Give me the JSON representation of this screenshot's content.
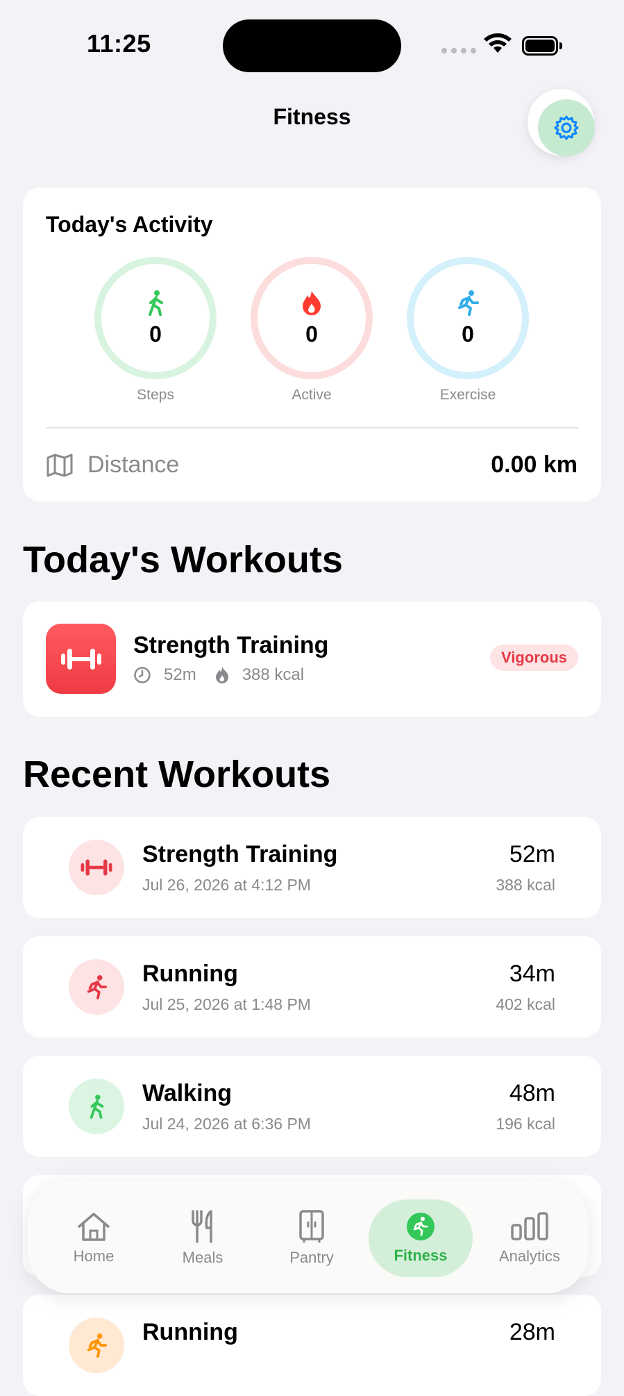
{
  "status_bar": {
    "time": "11:25"
  },
  "header": {
    "title": "Fitness",
    "settings_icon": "gear-icon"
  },
  "activity": {
    "title": "Today's Activity",
    "rings": [
      {
        "icon": "walk-icon",
        "value": "0",
        "label": "Steps",
        "color": "#34c759"
      },
      {
        "icon": "flame-icon",
        "value": "0",
        "label": "Active",
        "color": "#ff3b30"
      },
      {
        "icon": "run-icon",
        "value": "0",
        "label": "Exercise",
        "color": "#32ade6"
      }
    ],
    "distance_label": "Distance",
    "distance_value": "0.00 km"
  },
  "todays_workouts": {
    "title": "Today's Workouts",
    "items": [
      {
        "name": "Strength Training",
        "duration": "52m",
        "kcal": "388 kcal",
        "intensity": "Vigorous",
        "icon": "dumbbell-icon"
      }
    ]
  },
  "recent_workouts": {
    "title": "Recent Workouts",
    "items": [
      {
        "name": "Strength Training",
        "date": "Jul 26, 2026 at 4:12 PM",
        "duration": "52m",
        "kcal": "388 kcal",
        "icon": "dumbbell-icon"
      },
      {
        "name": "Running",
        "date": "Jul 25, 2026 at 1:48 PM",
        "duration": "34m",
        "kcal": "402 kcal",
        "icon": "run-icon"
      },
      {
        "name": "Walking",
        "date": "Jul 24, 2026 at 6:36 PM",
        "duration": "48m",
        "kcal": "196 kcal",
        "icon": "walk-icon"
      },
      {
        "name": "Running",
        "duration": "28m",
        "icon": "run-icon"
      }
    ]
  },
  "tab_bar": {
    "tabs": [
      {
        "label": "Home",
        "icon": "house-icon"
      },
      {
        "label": "Meals",
        "icon": "fork-knife-icon"
      },
      {
        "label": "Pantry",
        "icon": "cabinet-icon"
      },
      {
        "label": "Fitness",
        "icon": "run-icon",
        "active": true
      },
      {
        "label": "Analytics",
        "icon": "bar-chart-icon"
      }
    ]
  },
  "colors": {
    "accent_green": "#34c759",
    "red": "#ff3b30",
    "blue": "#32ade6",
    "orange": "#ff9500"
  }
}
